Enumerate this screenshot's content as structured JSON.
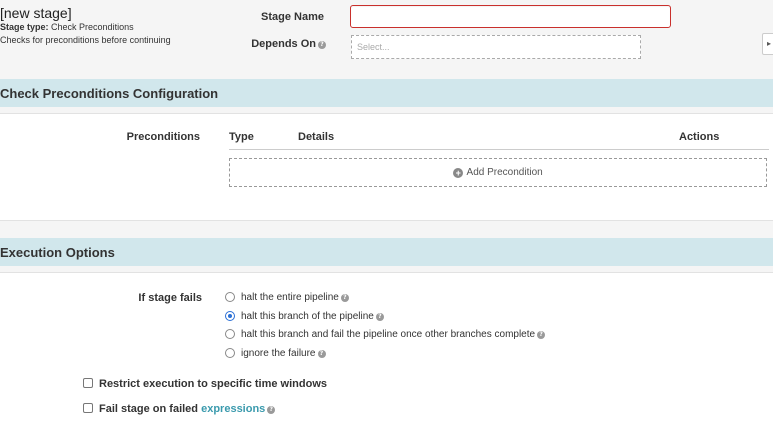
{
  "header": {
    "title": "[new stage]",
    "stage_type_label": "Stage type:",
    "stage_type_value": "Check Preconditions",
    "description": "Checks for preconditions before continuing"
  },
  "form": {
    "stage_name_label": "Stage Name",
    "stage_name_value": "",
    "depends_on_label": "Depends On",
    "depends_on_placeholder": "Select..."
  },
  "sections": {
    "preconditions_title": "Check Preconditions Configuration",
    "execution_title": "Execution Options"
  },
  "preconditions": {
    "label": "Preconditions",
    "columns": [
      "Type",
      "Details",
      "Actions"
    ],
    "add_label": "Add Precondition"
  },
  "execution": {
    "if_fails_label": "If stage fails",
    "options": [
      "halt the entire pipeline",
      "halt this branch of the pipeline",
      "halt this branch and fail the pipeline once other branches complete",
      "ignore the failure"
    ],
    "selected_index": 1,
    "restrict_label": "Restrict execution to specific time windows",
    "fail_stage_label": "Fail stage on failed",
    "expressions_link": "expressions"
  },
  "icons": {
    "help": "question-circle-icon",
    "add": "plus-circle-icon"
  },
  "colors": {
    "section_bar": "#d1e7ec",
    "error_border": "#c9302c",
    "link": "#3a9aad",
    "radio_selected": "#2a6fd6"
  }
}
